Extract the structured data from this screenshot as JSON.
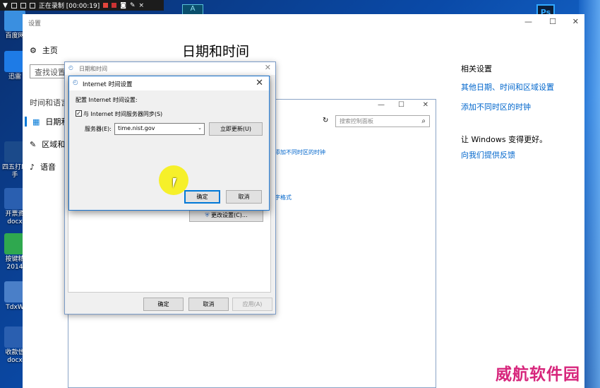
{
  "recorder": {
    "status": "正在录制 [00:00:19]"
  },
  "desktop": {
    "icons": [
      {
        "label": "百度网",
        "color": "#3a8fe0"
      },
      {
        "label": "迅雷",
        "color": "#1e7be6"
      },
      {
        "label": "四五打印手",
        "color": "#1b4a8a"
      },
      {
        "label": "开票资 docx",
        "color": "#2a5fb0"
      },
      {
        "label": "按键精 2014",
        "color": "#2fa84f"
      },
      {
        "label": "TdxW",
        "color": "#4a7fc8"
      },
      {
        "label": "收款信 docx",
        "color": "#2a5fb0"
      }
    ],
    "ps_label": "Ps",
    "app_label": "A"
  },
  "settings": {
    "window_title": "设置",
    "home_label": "主页",
    "search_placeholder": "查找设置",
    "section": "时间和语言",
    "nav": [
      "日期和",
      "区域和",
      "语音"
    ],
    "page_title": "日期和时间",
    "related_heading": "相关设置",
    "related_links": [
      "其他日期、时间和区域设置",
      "添加不同时区的时钟"
    ],
    "feedback_heading": "让 Windows 变得更好。",
    "feedback_link": "向我们提供反馈"
  },
  "control_panel": {
    "search_placeholder": "搜索控制面板",
    "link_clock": "添加不同时区的时钟",
    "link_format": "字格式",
    "change_button": "更改设置(C)..."
  },
  "datetime_dialog": {
    "title": "日期和时间",
    "ok": "确定",
    "cancel": "取消",
    "apply": "应用(A)"
  },
  "internet_time": {
    "title": "Internet 时间设置",
    "config_label": "配置 Internet 时间设置:",
    "sync_label": "与 Internet 时间服务器同步(S)",
    "sync_checked": true,
    "server_label": "服务器(E):",
    "server_value": "time.nist.gov",
    "update_button": "立即更新(U)",
    "ok": "确定",
    "cancel": "取消"
  },
  "watermark": "威航软件园"
}
